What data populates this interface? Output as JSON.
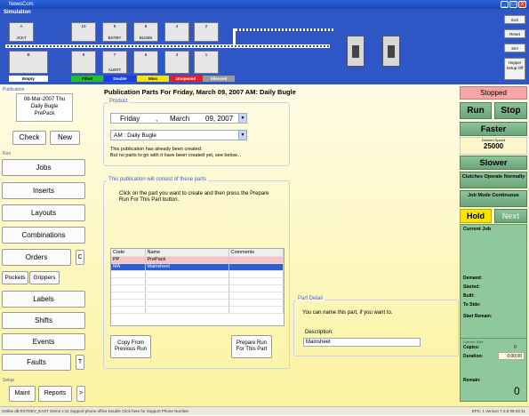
{
  "window": {
    "title": "NewsCom",
    "min": "_",
    "max": "□",
    "close": "x"
  },
  "sim": {
    "label": "Simulation",
    "top_slots": [
      {
        "num": "A",
        "name": "JCKT"
      },
      {
        "num": "10",
        "name": ""
      },
      {
        "num": "9",
        "name": "BSTBY"
      },
      {
        "num": "8",
        "name": "BLKBS"
      },
      {
        "num": "4",
        "name": ""
      },
      {
        "num": "2",
        "name": ""
      }
    ],
    "bottom_slots": [
      {
        "num": "B",
        "name": ""
      },
      {
        "num": "9",
        "name": ""
      },
      {
        "num": "7",
        "name": "ALERT"
      },
      {
        "num": "5",
        "name": ""
      },
      {
        "num": "3",
        "name": ""
      },
      {
        "num": "1",
        "name": ""
      }
    ],
    "legend": [
      {
        "label": "Empty",
        "color": "#ffffff"
      },
      {
        "label": "Filled",
        "color": "#22c02e"
      },
      {
        "label": "Double",
        "color": "#1a3fe0"
      },
      {
        "label": "Miss",
        "color": "#f8e400"
      },
      {
        "label": "Unopened",
        "color": "#ee1e1e"
      },
      {
        "label": "Silenced",
        "color": "#9a9a9a"
      }
    ],
    "right_buttons": [
      "Exit",
      "Reset",
      "Sim"
    ],
    "hopper": "Hopper Setup Off"
  },
  "left": {
    "pub_label": "Publication",
    "pub_lines": [
      "08-Mar-2007 Thu",
      "Daily Bugle",
      "PrePack"
    ],
    "check": "Check",
    "new": "New",
    "run_label": "Run",
    "buttons": [
      "Jobs",
      "Inserts",
      "Layouts",
      "Combinations",
      "Orders"
    ],
    "c_btn": "C",
    "pockets": "Pockets",
    "grippers": "Grippers",
    "buttons2": [
      "Labels",
      "Shifts",
      "Events",
      "Faults"
    ],
    "t_btn": "T",
    "setup_label": "Setup",
    "maint": "Maint",
    "reports": "Reports",
    "more": ">"
  },
  "center": {
    "heading": "Publication Parts For Friday, March 09, 2007 AM: Daily Bugle",
    "product_label": "Product",
    "date": {
      "day": "Friday",
      "sep": ",",
      "month": "March",
      "daynum": "09, 2007"
    },
    "edition": "AM : Daily Bugle",
    "msg1": "This publication has already been created.",
    "msg2": "But no parts to go with it have been created yet, see below...",
    "parts_label": "This publication will consist of these parts",
    "instr": "Click on the part you want to create and then press the Prepare Run For This Part button.",
    "cols": [
      "Code",
      "Name",
      "Comments"
    ],
    "rows": [
      {
        "code": "PP",
        "name": "PrePack",
        "comments": ""
      },
      {
        "code": "MA",
        "name": "Mainsheet",
        "comments": ""
      }
    ],
    "copy_btn": "Copy From Previous Run",
    "prepare_btn": "Prepare Run For This Part",
    "detail_label": "Part Detail",
    "detail_msg": "You can name this part, if you want to.",
    "desc_label": "Description:",
    "desc_value": "Mainsheet"
  },
  "right": {
    "stopped": "Stopped",
    "run": "Run",
    "stop": "Stop",
    "faster": "Faster",
    "speed_label": "Desired Speed",
    "speed": "25000",
    "slower": "Slower",
    "clutches": "Clutches Operate Normally",
    "jobmode": "Job Mode Continuous",
    "hold": "Hold",
    "next": "Next",
    "current_job": "Current Job",
    "fields": [
      "Demand:",
      "Started:",
      "Built:",
      "To Stde:",
      "Start Remain:"
    ],
    "shift_label": "Current Shift",
    "copies_label": "Copies:",
    "copies": "0",
    "duration_label": "Duration:",
    "duration": "0:00:00",
    "remain_label": "Remain:",
    "remain": "0"
  },
  "status": {
    "text": "Online      db:RSTDEV_EAST Demo   v:11    Support phone office   Double Click here for Support Phone Number",
    "right": "EPS: 1    Version 7.3.8    09:43:31"
  }
}
